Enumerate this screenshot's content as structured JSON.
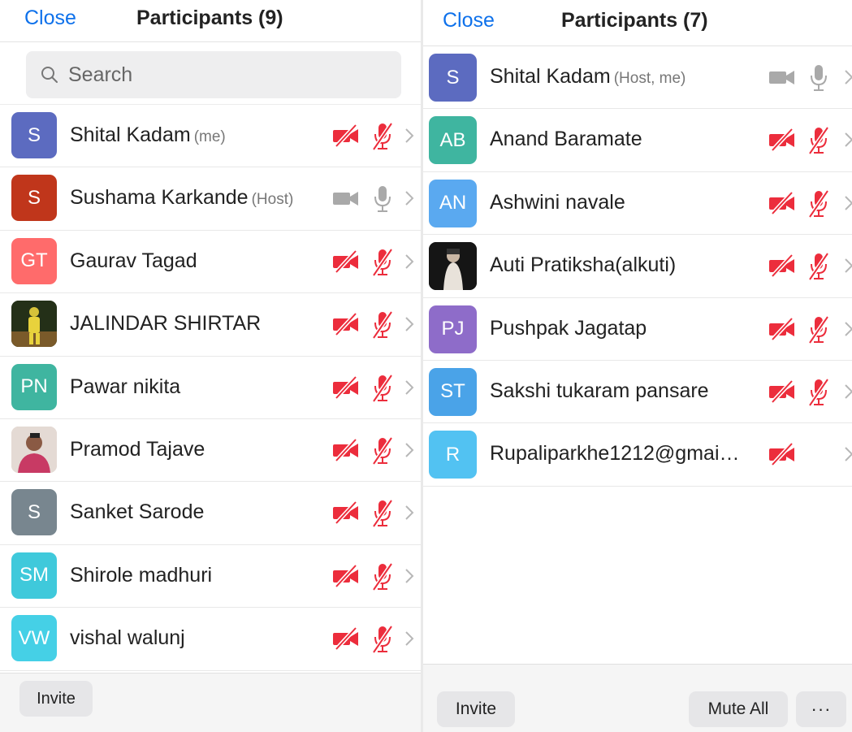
{
  "colors": {
    "accent": "#0e71eb",
    "muted_red": "#ec2d3c",
    "active_gray": "#a9a9a9"
  },
  "left_panel": {
    "close_label": "Close",
    "title": "Participants (9)",
    "search": {
      "placeholder": "Search"
    },
    "participants": [
      {
        "initials": "S",
        "name": "Shital Kadam",
        "role": "(me)",
        "avatar_color": "#5c6bc0",
        "video_icon": "video-off-icon",
        "mic_icon": "mic-off-icon"
      },
      {
        "initials": "S",
        "name": "Sushama Karkande",
        "role": "(Host)",
        "avatar_color": "#c0361b",
        "video_icon": "video-on-icon",
        "mic_icon": "mic-on-icon"
      },
      {
        "initials": "GT",
        "name": "Gaurav Tagad",
        "role": "",
        "avatar_color": "#ff6b6b",
        "video_icon": "video-off-icon",
        "mic_icon": "mic-off-icon"
      },
      {
        "initials": "",
        "name": "JALINDAR SHIRTAR",
        "role": "",
        "avatar_color": "#2e3b1f",
        "photo": true,
        "video_icon": "video-off-icon",
        "mic_icon": "mic-off-icon"
      },
      {
        "initials": "PN",
        "name": "Pawar nikita",
        "role": "",
        "avatar_color": "#3fb5a0",
        "video_icon": "video-off-icon",
        "mic_icon": "mic-off-icon"
      },
      {
        "initials": "",
        "name": "Pramod Tajave",
        "role": "",
        "avatar_color": "#d8c7c0",
        "photo": true,
        "video_icon": "video-off-icon",
        "mic_icon": "mic-off-icon"
      },
      {
        "initials": "S",
        "name": "Sanket Sarode",
        "role": "",
        "avatar_color": "#78868f",
        "video_icon": "video-off-icon",
        "mic_icon": "mic-off-icon"
      },
      {
        "initials": "SM",
        "name": "Shirole madhuri",
        "role": "",
        "avatar_color": "#3fc9db",
        "video_icon": "video-off-icon",
        "mic_icon": "mic-off-icon"
      },
      {
        "initials": "VW",
        "name": "vishal walunj",
        "role": "",
        "avatar_color": "#45d0e6",
        "video_icon": "video-off-icon",
        "mic_icon": "mic-off-icon"
      }
    ],
    "invite_label": "Invite"
  },
  "right_panel": {
    "close_label": "Close",
    "title": "Participants (7)",
    "participants": [
      {
        "initials": "S",
        "name": "Shital Kadam",
        "role": "(Host, me)",
        "avatar_color": "#5c6bc0",
        "video_icon": "video-on-icon",
        "mic_icon": "mic-on-icon"
      },
      {
        "initials": "AB",
        "name": "Anand Baramate",
        "role": "",
        "avatar_color": "#3fb5a0",
        "video_icon": "video-off-icon",
        "mic_icon": "mic-off-icon"
      },
      {
        "initials": "AN",
        "name": "Ashwini navale",
        "role": "",
        "avatar_color": "#5aa9f0",
        "video_icon": "video-off-icon",
        "mic_icon": "mic-off-icon"
      },
      {
        "initials": "",
        "name": "Auti Pratiksha(alkuti)",
        "role": "",
        "avatar_color": "#1a1a1a",
        "photo": true,
        "video_icon": "video-off-icon",
        "mic_icon": "mic-off-icon"
      },
      {
        "initials": "PJ",
        "name": "Pushpak Jagatap",
        "role": "",
        "avatar_color": "#8e6cc9",
        "video_icon": "video-off-icon",
        "mic_icon": "mic-off-icon"
      },
      {
        "initials": "ST",
        "name": "Sakshi tukaram pansare",
        "role": "",
        "avatar_color": "#4aa3e8",
        "video_icon": "video-off-icon",
        "mic_icon": "mic-off-icon"
      },
      {
        "initials": "R",
        "name": "Rupaliparkhe1212@gmai…",
        "role": "",
        "avatar_color": "#52c2f2",
        "video_icon": "video-off-icon",
        "mic_icon": ""
      }
    ],
    "invite_label": "Invite",
    "mute_all_label": "Mute All",
    "more_label": "···"
  }
}
